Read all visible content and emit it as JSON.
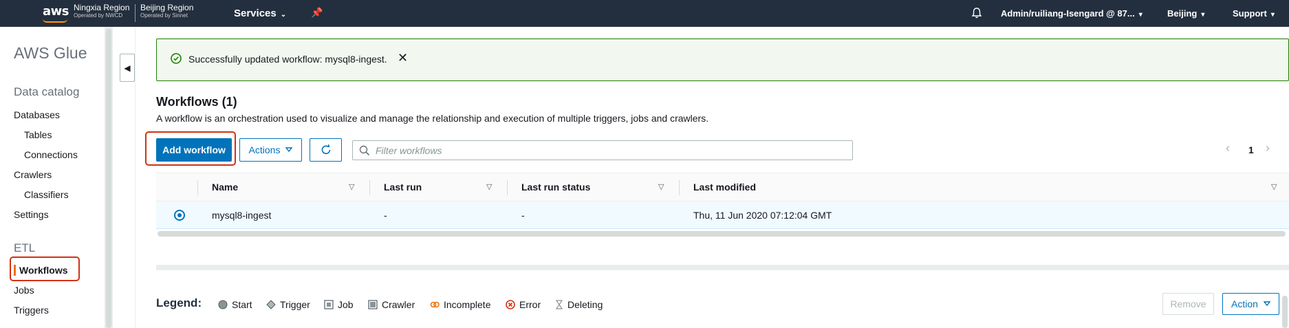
{
  "topnav": {
    "logo": "aws",
    "region_ningxia": {
      "name": "Ningxia Region",
      "operator": "Operated by NWCD"
    },
    "region_beijing": {
      "name": "Beijing Region",
      "operator": "Operated by Sinnet"
    },
    "services": "Services",
    "user": "Admin/ruiliang-Isengard @ 87...",
    "region": "Beijing",
    "support": "Support",
    "icons": [
      "caret-down-icon",
      "pin-icon",
      "bell-icon"
    ]
  },
  "sidebar": {
    "title": "AWS Glue",
    "sections": [
      {
        "label": "Data catalog",
        "items": [
          "Databases",
          "Tables",
          "Connections",
          "Crawlers",
          "Classifiers",
          "Settings"
        ]
      },
      {
        "label": "ETL",
        "items": [
          "Workflows",
          "Jobs",
          "Triggers"
        ]
      }
    ],
    "active_item": "Workflows"
  },
  "flash": {
    "message": "Successfully updated workflow: mysql8-ingest.",
    "status": "success",
    "color": "#1d8102"
  },
  "header": {
    "title": "Workflows (1)",
    "description": "A workflow is an orchestration used to visualize and manage the relationship and execution of multiple triggers, jobs and crawlers."
  },
  "toolbar": {
    "add_label": "Add workflow",
    "actions_label": "Actions",
    "filter_placeholder": "Filter workflows",
    "page": "1"
  },
  "table": {
    "columns": [
      "Name",
      "Last run",
      "Last run status",
      "Last modified"
    ],
    "rows": [
      {
        "selected": true,
        "name": "mysql8-ingest",
        "last_run": "-",
        "last_run_status": "-",
        "last_modified": "Thu, 11 Jun 2020 07:12:04 GMT"
      }
    ]
  },
  "legend": {
    "title": "Legend:",
    "items": [
      {
        "label": "Start",
        "icon": "start-circle-icon"
      },
      {
        "label": "Trigger",
        "icon": "trigger-diamond-icon"
      },
      {
        "label": "Job",
        "icon": "job-square-icon"
      },
      {
        "label": "Crawler",
        "icon": "crawler-square-icon"
      },
      {
        "label": "Incomplete",
        "icon": "incomplete-icon"
      },
      {
        "label": "Error",
        "icon": "error-icon"
      },
      {
        "label": "Deleting",
        "icon": "deleting-icon"
      }
    ]
  },
  "graph_actions": {
    "remove_label": "Remove",
    "action_label": "Action"
  },
  "colors": {
    "nav_bg": "#232f3e",
    "primary": "#0073bb",
    "accent_orange": "#ec7211",
    "highlight_red": "#d13212"
  }
}
